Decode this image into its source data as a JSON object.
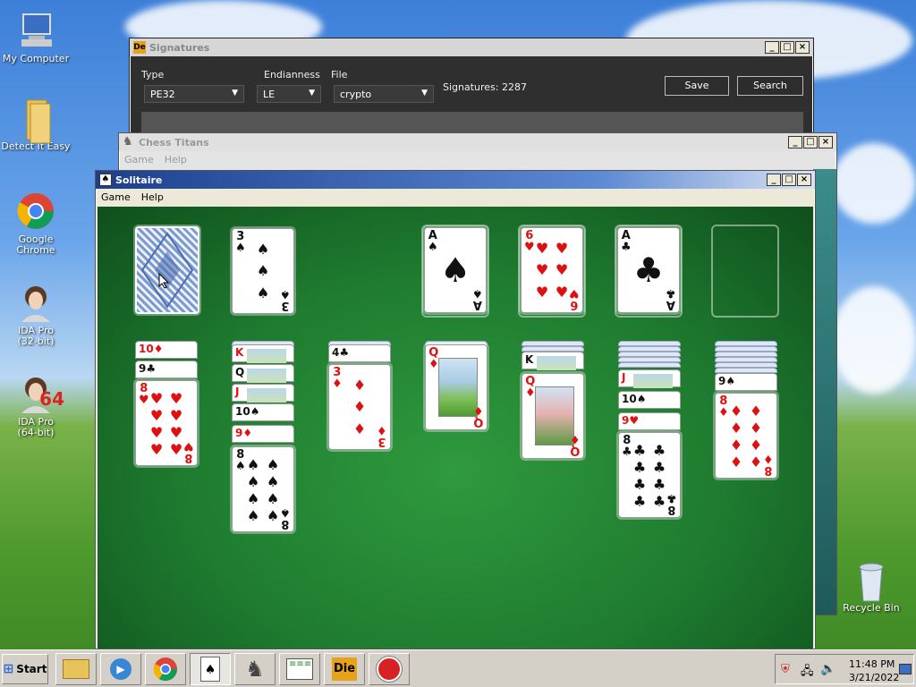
{
  "desktop": {
    "icons": [
      {
        "label": "My Computer"
      },
      {
        "label": "Detect It Easy"
      },
      {
        "label": "Google Chrome"
      },
      {
        "label": "IDA Pro\n(32-bit)"
      },
      {
        "label": "IDA Pro\n(64-bit)"
      },
      {
        "label": "Recycle Bin"
      }
    ],
    "ida64_badge": "64"
  },
  "signatures_window": {
    "title": "Signatures",
    "type_label": "Type",
    "type_value": "PE32",
    "endianness_label": "Endianness",
    "endianness_value": "LE",
    "file_label": "File",
    "file_value": "crypto",
    "signatures_count": "Signatures: 2287",
    "save_label": "Save",
    "search_label": "Search"
  },
  "chess_window": {
    "title": "Chess Titans",
    "menu": [
      "Game",
      "Help"
    ]
  },
  "solitaire_window": {
    "title": "Solitaire",
    "menu": [
      "Game",
      "Help"
    ],
    "waste_card": {
      "rank": "3",
      "suit": "♠"
    },
    "foundations": [
      {
        "rank": "A",
        "suit": "♠",
        "color": "black"
      },
      {
        "rank": "6",
        "suit": "♥",
        "color": "red"
      },
      {
        "rank": "A",
        "suit": "♣",
        "color": "black"
      }
    ],
    "tableau": [
      {
        "stubs": [
          {
            "rank": "10",
            "suit": "♦",
            "color": "red"
          },
          {
            "rank": "9",
            "suit": "♣",
            "color": "black"
          }
        ],
        "top": {
          "rank": "8",
          "suit": "♥",
          "color": "red"
        }
      },
      {
        "stubs": [
          {
            "rank": "K",
            "suit": "",
            "color": "red"
          },
          {
            "rank": "Q",
            "suit": "",
            "color": "black"
          },
          {
            "rank": "J",
            "suit": "",
            "color": "red"
          },
          {
            "rank": "10",
            "suit": "♠",
            "color": "black"
          },
          {
            "rank": "9",
            "suit": "♦",
            "color": "red"
          }
        ],
        "top": {
          "rank": "8",
          "suit": "♠",
          "color": "black"
        }
      },
      {
        "stubs": [
          {
            "rank": "4",
            "suit": "♣",
            "color": "black"
          }
        ],
        "top": {
          "rank": "3",
          "suit": "♦",
          "color": "red"
        }
      },
      {
        "stubs": [],
        "top": {
          "rank": "Q",
          "suit": "♦",
          "color": "red"
        }
      },
      {
        "stubs": [
          {
            "rank": "K",
            "suit": "",
            "color": "black"
          }
        ],
        "top": {
          "rank": "Q",
          "suit": "♦",
          "color": "red"
        }
      },
      {
        "stubs": [
          {
            "rank": "J",
            "suit": "",
            "color": "red"
          },
          {
            "rank": "10",
            "suit": "♠",
            "color": "black"
          },
          {
            "rank": "9",
            "suit": "♥",
            "color": "red"
          }
        ],
        "top": {
          "rank": "8",
          "suit": "♣",
          "color": "black"
        }
      },
      {
        "stubs": [
          {
            "rank": "9",
            "suit": "♠",
            "color": "black"
          }
        ],
        "top": {
          "rank": "8",
          "suit": "♦",
          "color": "red"
        }
      }
    ]
  },
  "taskbar": {
    "start_label": "Start",
    "clock_time": "11:48 PM",
    "clock_date": "3/21/2022",
    "ide_label": "Die"
  },
  "colors": {
    "felt": "#1e7a2f",
    "solitaire_title": "#2a5db0",
    "dark_panel": "#2f2f2f"
  }
}
